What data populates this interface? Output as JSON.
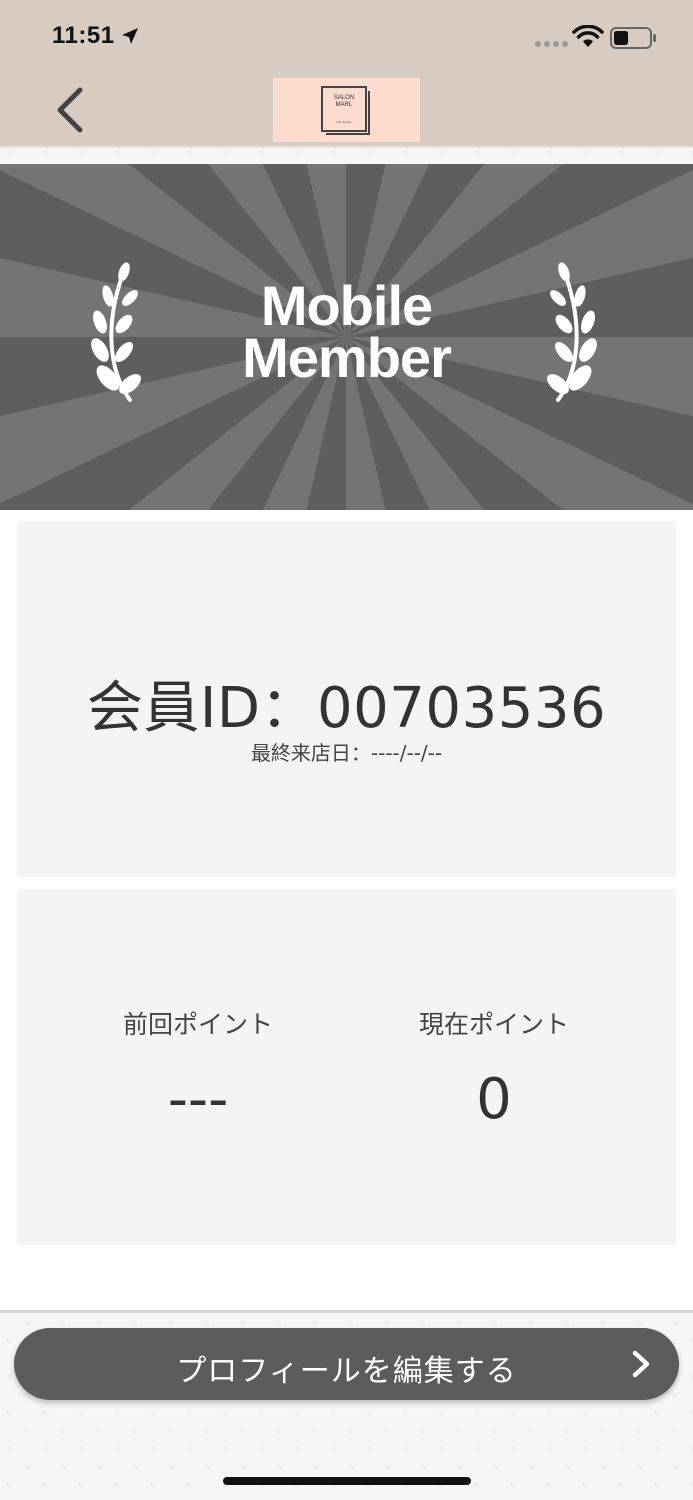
{
  "status_bar": {
    "time": "11:51"
  },
  "nav": {
    "logo": {
      "title": "SALON\nMARL",
      "subtitle": "hair design"
    }
  },
  "banner": {
    "title_line1": "Mobile",
    "title_line2": "Member"
  },
  "member_card": {
    "id_label": "会員ID：",
    "id_value": "00703536",
    "last_visit_label": "最終来店日：",
    "last_visit_value": "----/--/--"
  },
  "points": {
    "previous_label": "前回ポイント",
    "previous_value": "---",
    "current_label": "現在ポイント",
    "current_value": "0"
  },
  "edit_button": {
    "label": "プロフィールを編集する"
  },
  "colors": {
    "nav_bg": "#d8cbc2",
    "logo_bg": "#fbdccf",
    "banner_bg": "#5e5e5e",
    "button_bg": "#5c5c5c",
    "card_bg": "#f4f4f4"
  }
}
